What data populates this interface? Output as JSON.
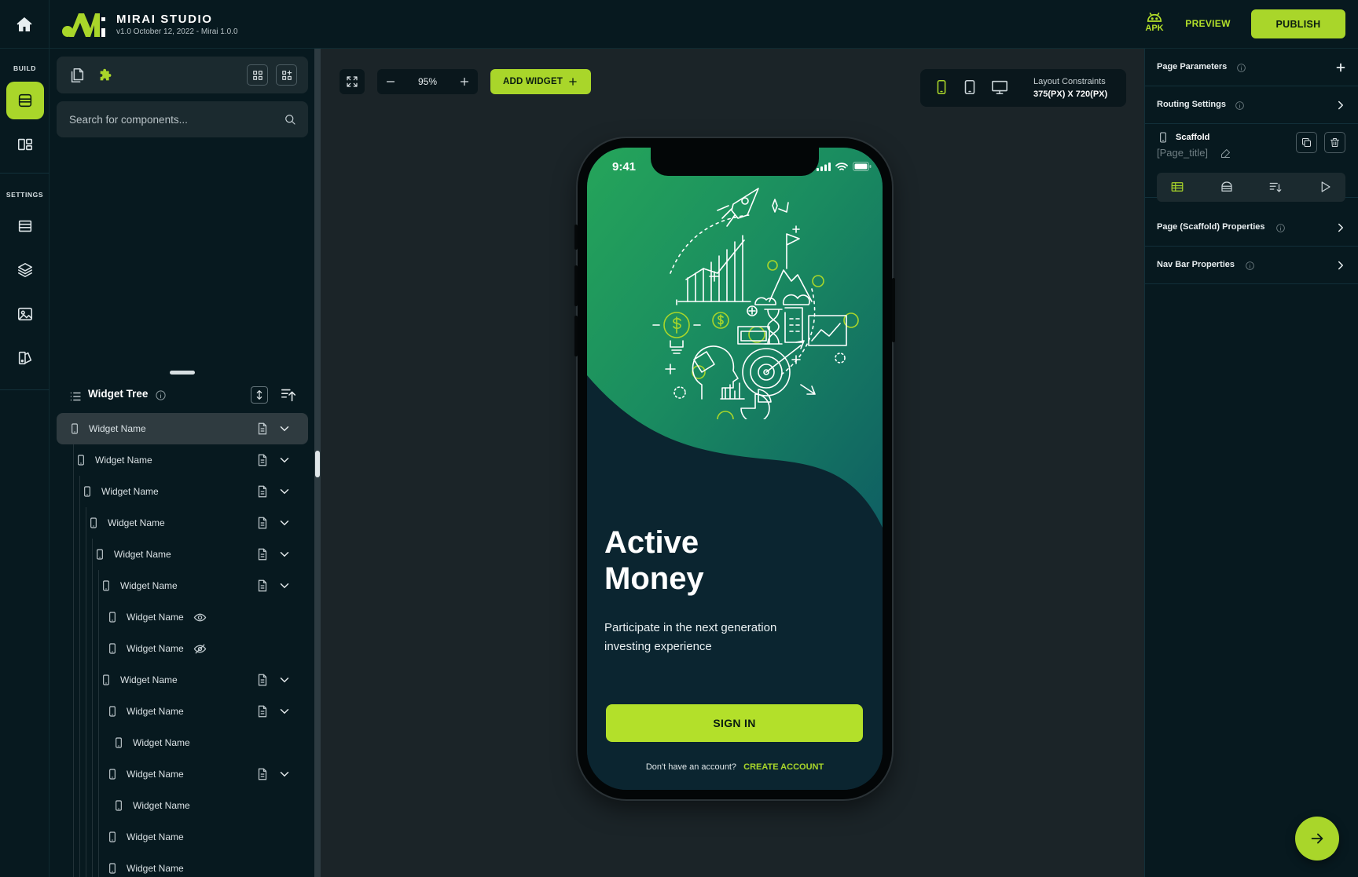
{
  "app": {
    "brand_name": "MIRAI STUDIO",
    "version": "v1.0 October 12, 2022 - Mirai 1.0.0"
  },
  "topbar": {
    "apk_label": "APK",
    "preview_label": "PREVIEW",
    "publish_label": "PUBLISH"
  },
  "rail": {
    "build_label": "BUILD",
    "settings_label": "SETTINGS",
    "items": [
      {
        "icon": "widget-builder-icon",
        "active": true
      },
      {
        "icon": "layout-icon",
        "active": false
      },
      {
        "icon": "list-icon",
        "active": false
      },
      {
        "icon": "layers-icon",
        "active": false
      },
      {
        "icon": "image-icon",
        "active": false
      },
      {
        "icon": "theme-icon",
        "active": false
      }
    ]
  },
  "components": {
    "search_placeholder": "Search for components..."
  },
  "widget_tree": {
    "title": "Widget Tree",
    "rows": [
      {
        "label": "Widget Name",
        "selected": true
      },
      {
        "label": "Widget Name"
      },
      {
        "label": "Widget Name"
      },
      {
        "label": "Widget Name"
      },
      {
        "label": "Widget Name"
      },
      {
        "label": "Widget Name"
      },
      {
        "label": "Widget Name",
        "visibility": "visible"
      },
      {
        "label": "Widget Name",
        "visibility": "hidden"
      },
      {
        "label": "Widget Name"
      },
      {
        "label": "Widget Name"
      },
      {
        "label": "Widget Name"
      },
      {
        "label": "Widget Name"
      },
      {
        "label": "Widget Name"
      },
      {
        "label": "Widget Name"
      },
      {
        "label": "Widget Name"
      }
    ]
  },
  "canvas": {
    "zoom": "95%",
    "add_widget_label": "ADD WIDGET",
    "layout_constraints_label": "Layout Constraints",
    "layout_constraints_value": "375(PX) X 720(PX)",
    "active_device": "mobile"
  },
  "phone": {
    "status_time": "9:41",
    "hero_title_line1": "Active",
    "hero_title_line2": "Money",
    "hero_subtitle_line1": "Participate in the next generation",
    "hero_subtitle_line2": "investing experience",
    "signin_label": "SIGN IN",
    "signup_prompt": "Don't have an account?",
    "create_account_label": "CREATE ACCOUNT"
  },
  "right_panel": {
    "page_parameters": "Page Parameters",
    "routing_settings": "Routing Settings",
    "scaffold_name": "Scaffold",
    "scaffold_title": "[Page_title]",
    "page_properties": "Page (Scaffold) Properties",
    "nav_bar_properties": "Nav Bar Properties"
  },
  "colors": {
    "accent": "#a9d62a",
    "panel_dark": "#07191f",
    "canvas_bg": "#1b2428",
    "phone_screen": "#0b2530"
  }
}
